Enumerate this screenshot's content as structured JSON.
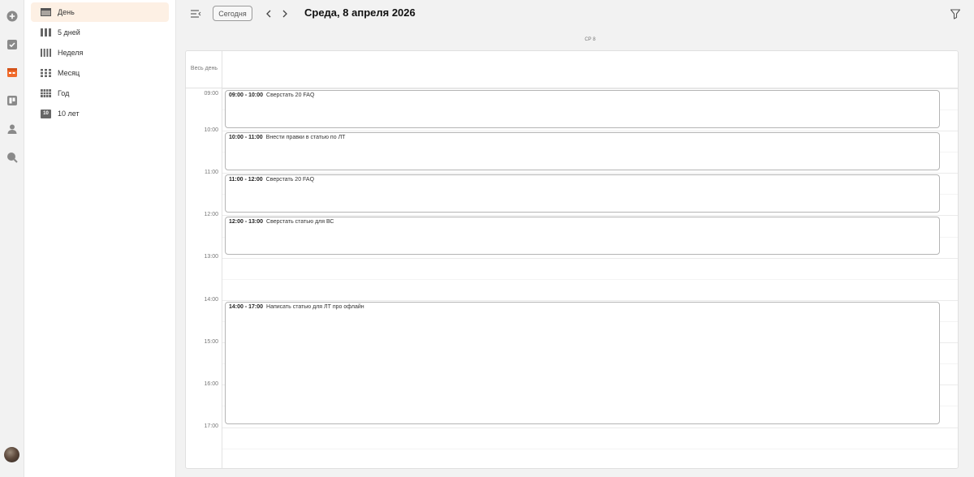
{
  "rail": {
    "items": [
      {
        "name": "add-icon",
        "color": "#8a8a8a"
      },
      {
        "name": "tasks-icon",
        "color": "#8a8a8a"
      },
      {
        "name": "calendar-icon",
        "color": "#f06a2a"
      },
      {
        "name": "board-icon",
        "color": "#8a8a8a"
      },
      {
        "name": "contacts-icon",
        "color": "#8a8a8a"
      },
      {
        "name": "search-icon",
        "color": "#8a8a8a"
      }
    ]
  },
  "views": {
    "items": [
      {
        "label": "День",
        "icon": "day-view-icon",
        "active": true
      },
      {
        "label": "5 дней",
        "icon": "five-days-view-icon",
        "active": false
      },
      {
        "label": "Неделя",
        "icon": "week-view-icon",
        "active": false
      },
      {
        "label": "Месяц",
        "icon": "month-view-icon",
        "active": false
      },
      {
        "label": "Год",
        "icon": "year-view-icon",
        "active": false
      },
      {
        "label": "10 лет",
        "icon": "decade-view-icon",
        "badge": "10",
        "active": false
      }
    ]
  },
  "toolbar": {
    "today_label": "Сегодня",
    "title": "Среда, 8 апреля 2026"
  },
  "calendar": {
    "day_header": "СР 8",
    "allday_label": "Весь день",
    "hours": [
      "09:00",
      "10:00",
      "11:00",
      "12:00",
      "13:00",
      "14:00",
      "15:00",
      "16:00",
      "17:00"
    ],
    "events": [
      {
        "time": "09:00 - 10:00",
        "title": "Сверстать 20 FAQ"
      },
      {
        "time": "10:00 - 11:00",
        "title": "Внести правки в статью по ЛТ"
      },
      {
        "time": "11:00 - 12:00",
        "title": "Сверстать 20 FAQ"
      },
      {
        "time": "12:00 - 13:00",
        "title": "Сверстать статью для ВС"
      },
      {
        "time": "14:00 - 17:00",
        "title": "Написать статью для ЛТ про офлайн"
      }
    ]
  },
  "colors": {
    "accent": "#f06a2a",
    "active_bg": "#fdf0e4"
  }
}
